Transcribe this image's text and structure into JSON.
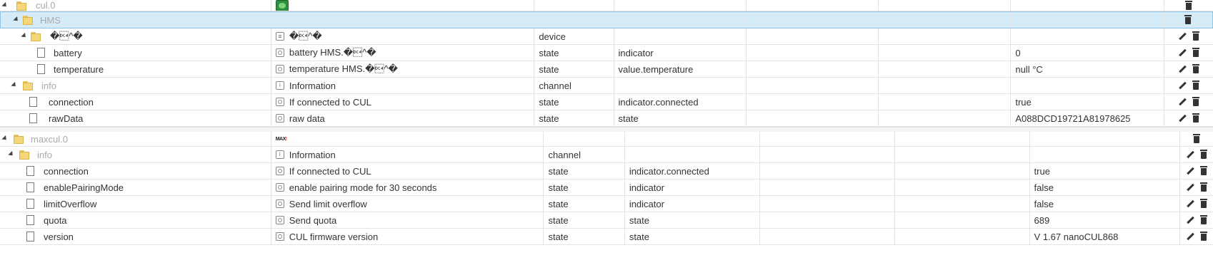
{
  "sections": [
    {
      "id": "cul",
      "rows": [
        {
          "kind": "root",
          "label": "cul.0",
          "logo": "cul-adapter-logo"
        },
        {
          "kind": "folder",
          "label": "HMS",
          "selected": true
        },
        {
          "kind": "folder",
          "label": "�\u0014^�",
          "name": "�\u0014^�",
          "name_icon": "device-icon",
          "type": "device",
          "role": "",
          "value": ""
        },
        {
          "kind": "file",
          "label": "battery",
          "name": "battery HMS.�\u0014^�",
          "name_icon": "state-icon",
          "type": "state",
          "role": "indicator",
          "value": "0"
        },
        {
          "kind": "file",
          "label": "temperature",
          "name": "temperature HMS.�\u0014^�",
          "name_icon": "state-icon",
          "type": "state",
          "role": "value.temperature",
          "value": "null °C"
        },
        {
          "kind": "folder",
          "label": "info",
          "name": "Information",
          "name_icon": "channel-icon",
          "type": "channel",
          "role": "",
          "value": ""
        },
        {
          "kind": "file",
          "label": "connection",
          "name": "If connected to CUL",
          "name_icon": "state-icon",
          "type": "state",
          "role": "indicator.connected",
          "value": "true"
        },
        {
          "kind": "file",
          "label": "rawData",
          "name": "raw data",
          "name_icon": "state-icon",
          "type": "state",
          "role": "state",
          "value": "A088DCD19721A81978625"
        }
      ]
    },
    {
      "id": "maxcul",
      "rows": [
        {
          "kind": "root",
          "label": "maxcul.0",
          "logo": "max-adapter-logo",
          "logo_text": "MAX",
          "logo_accent": "!"
        },
        {
          "kind": "folder",
          "label": "info",
          "name": "Information",
          "name_icon": "channel-icon",
          "type": "channel",
          "role": "",
          "value": ""
        },
        {
          "kind": "file",
          "label": "connection",
          "name": "If connected to CUL",
          "name_icon": "state-icon",
          "type": "state",
          "role": "indicator.connected",
          "value": "true"
        },
        {
          "kind": "file",
          "label": "enablePairingMode",
          "name": "enable pairing mode for 30 seconds",
          "name_icon": "state-icon",
          "type": "state",
          "role": "indicator",
          "value": "false"
        },
        {
          "kind": "file",
          "label": "limitOverflow",
          "name": "Send limit overflow",
          "name_icon": "state-icon",
          "type": "state",
          "role": "indicator",
          "value": "false"
        },
        {
          "kind": "file",
          "label": "quota",
          "name": "Send quota",
          "name_icon": "state-icon",
          "type": "state",
          "role": "state",
          "value": "689"
        },
        {
          "kind": "file",
          "label": "version",
          "name": "CUL firmware version",
          "name_icon": "state-icon",
          "type": "state",
          "role": "state",
          "value": "V 1.67 nanoCUL868"
        }
      ]
    }
  ]
}
